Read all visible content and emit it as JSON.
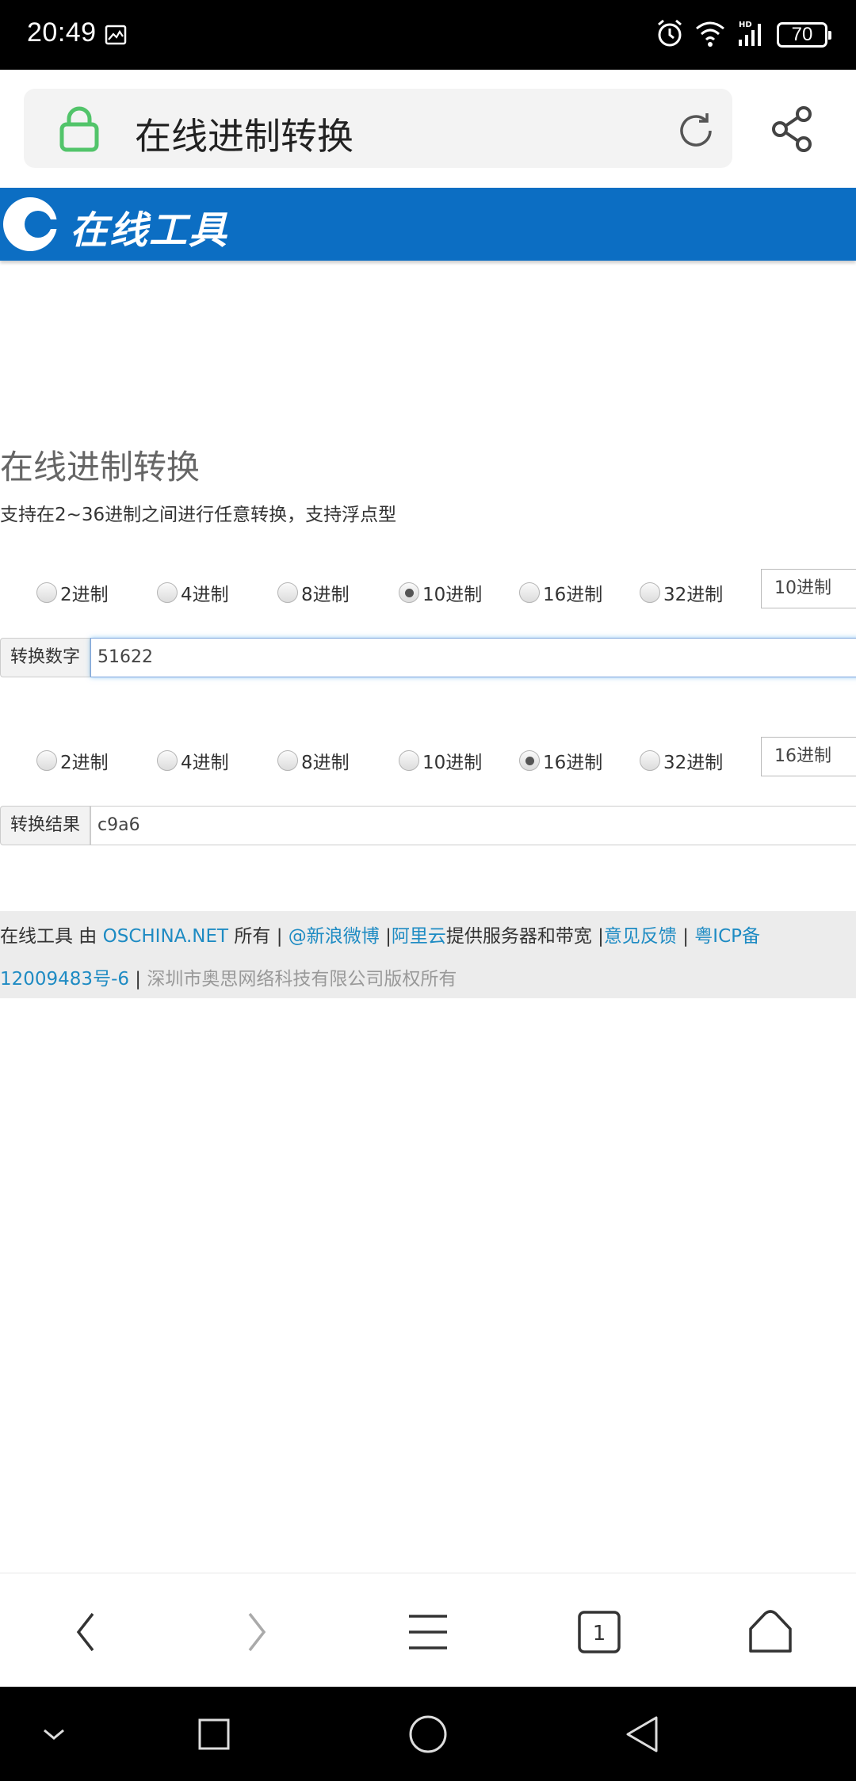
{
  "status_bar": {
    "time": "20:49",
    "battery": "70",
    "icons": [
      "gallery-icon",
      "alarm-icon",
      "wifi-icon",
      "signal-icon",
      "battery-icon"
    ]
  },
  "browser": {
    "tab_title": "在线进制转换",
    "icons": [
      "lock-icon",
      "reload-icon",
      "share-icon"
    ]
  },
  "site": {
    "logo_text": "在线工具",
    "brand_color": "#0c6ec3"
  },
  "page": {
    "title": "在线进制转换",
    "description": "支持在2~36进制之间进行任意转换，支持浮点型"
  },
  "input_section": {
    "radios": [
      {
        "label": "2进制",
        "checked": false
      },
      {
        "label": "4进制",
        "checked": false
      },
      {
        "label": "8进制",
        "checked": false
      },
      {
        "label": "10进制",
        "checked": true
      },
      {
        "label": "16进制",
        "checked": false
      },
      {
        "label": "32进制",
        "checked": false
      }
    ],
    "select_value": "10进制",
    "field_label": "转换数字",
    "field_value": "51622"
  },
  "output_section": {
    "radios": [
      {
        "label": "2进制",
        "checked": false
      },
      {
        "label": "4进制",
        "checked": false
      },
      {
        "label": "8进制",
        "checked": false
      },
      {
        "label": "10进制",
        "checked": false
      },
      {
        "label": "16进制",
        "checked": true
      },
      {
        "label": "32进制",
        "checked": false
      }
    ],
    "select_value": "16进制",
    "field_label": "转换结果",
    "field_value": "c9a6"
  },
  "footer": {
    "t1": "在线工具 由 ",
    "link_oschina": "OSCHINA.NET",
    "t2": " 所有 | ",
    "link_weibo": "@新浪微博",
    "t3": " |",
    "link_aliyun": "阿里云",
    "t4": "提供服务器和带宽 |",
    "link_feedback": "意见反馈",
    "t5": " | ",
    "link_icp_a": "粤ICP备",
    "link_icp_b": "12009483号-6",
    "t6": " | ",
    "copyright": "深圳市奥思网络科技有限公司版权所有",
    "link_color": "#1e8bc3"
  },
  "bottom_toolbar": {
    "tab_count": "1",
    "icons": [
      "back-icon",
      "forward-icon",
      "menu-icon",
      "tabs-icon",
      "home-icon"
    ]
  },
  "nav_bar": {
    "icons": [
      "collapse-icon",
      "recents-icon",
      "home-circle-icon",
      "back-triangle-icon"
    ]
  }
}
